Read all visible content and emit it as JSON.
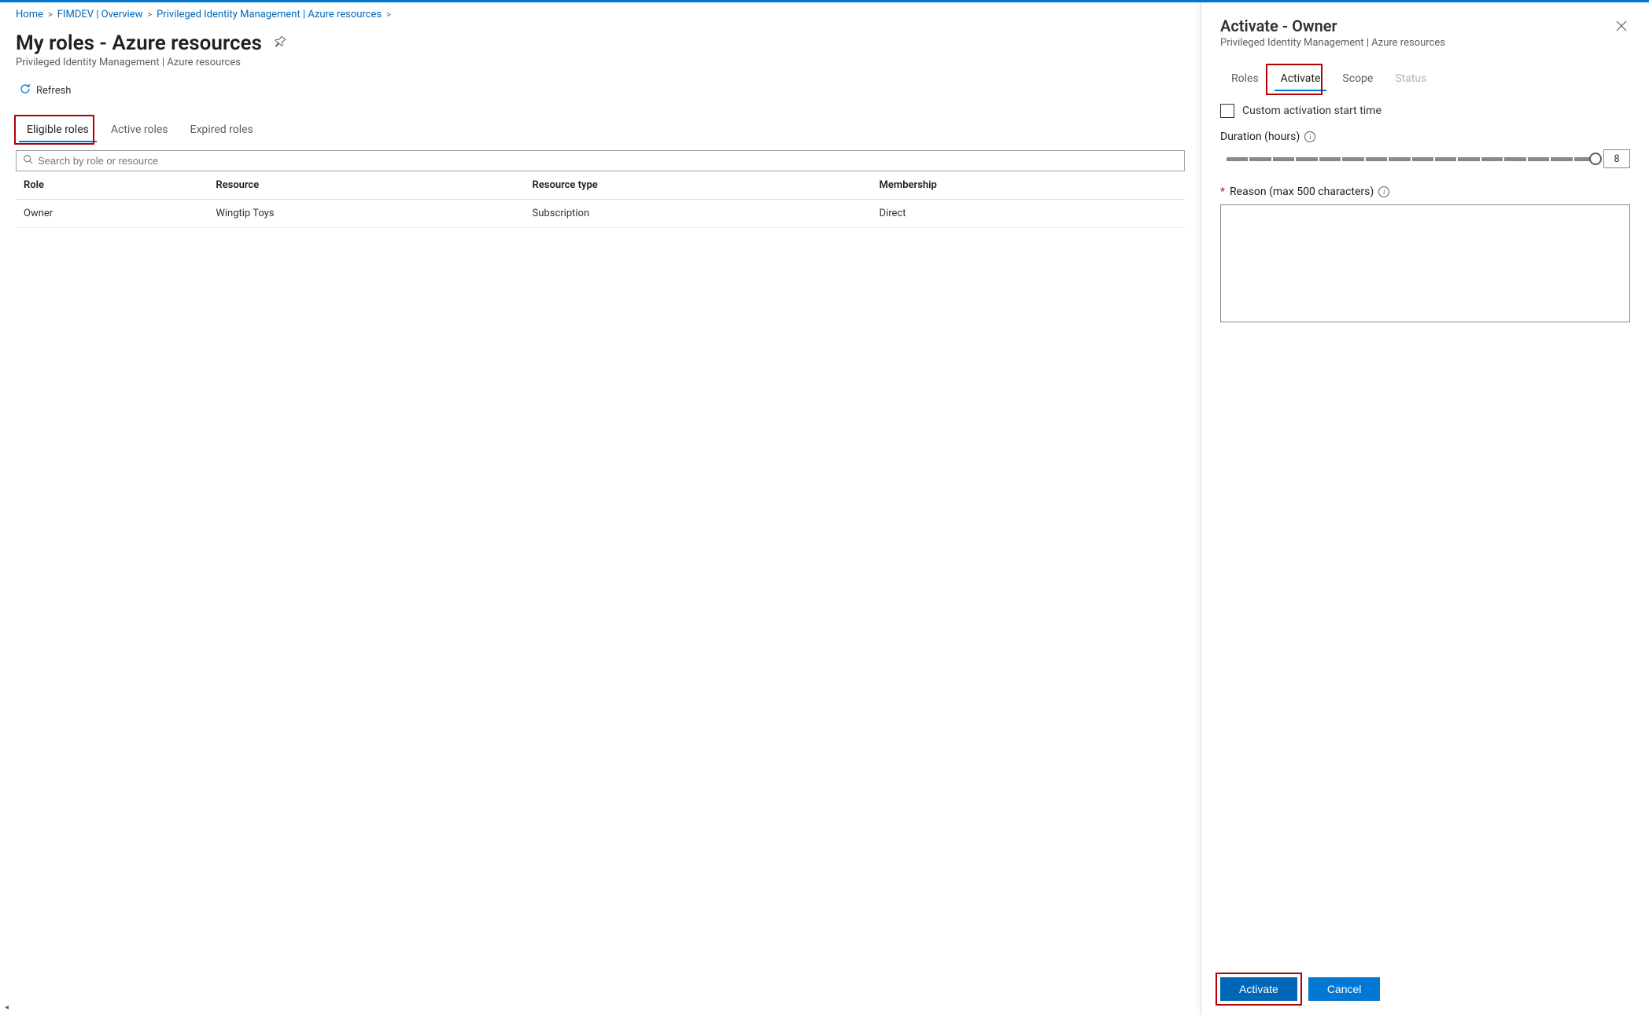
{
  "breadcrumb": {
    "items": [
      "Home",
      "FIMDEV | Overview",
      "Privileged Identity Management | Azure resources"
    ]
  },
  "page": {
    "title": "My roles - Azure resources",
    "subtitle": "Privileged Identity Management | Azure resources"
  },
  "toolbar": {
    "refresh": "Refresh"
  },
  "tabs": {
    "items": [
      "Eligible roles",
      "Active roles",
      "Expired roles"
    ],
    "active_index": 0
  },
  "search": {
    "placeholder": "Search by role or resource"
  },
  "table": {
    "headers": [
      "Role",
      "Resource",
      "Resource type",
      "Membership"
    ],
    "rows": [
      {
        "role": "Owner",
        "resource": "Wingtip Toys",
        "resource_type": "Subscription",
        "membership": "Direct"
      }
    ]
  },
  "panel": {
    "title": "Activate - Owner",
    "subtitle": "Privileged Identity Management | Azure resources",
    "tabs": [
      "Roles",
      "Activate",
      "Scope",
      "Status"
    ],
    "tabs_active_index": 1,
    "tabs_disabled_index": 3,
    "custom_start_label": "Custom activation start time",
    "duration_label": "Duration (hours)",
    "duration_value": "8",
    "duration_segments": 16,
    "reason_label": "Reason (max 500 characters)",
    "buttons": {
      "activate": "Activate",
      "cancel": "Cancel"
    }
  },
  "icons": {
    "info_glyph": "i"
  }
}
